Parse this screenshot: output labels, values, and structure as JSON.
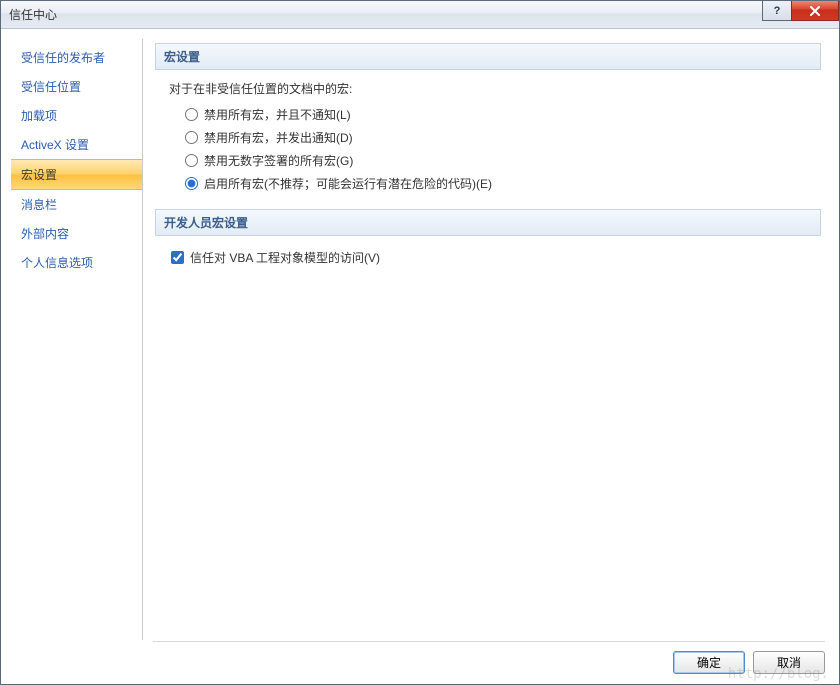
{
  "window": {
    "title": "信任中心"
  },
  "sidebar": {
    "items": [
      {
        "label": "受信任的发布者",
        "selected": false
      },
      {
        "label": "受信任位置",
        "selected": false
      },
      {
        "label": "加载项",
        "selected": false
      },
      {
        "label": "ActiveX 设置",
        "selected": false
      },
      {
        "label": "宏设置",
        "selected": true
      },
      {
        "label": "消息栏",
        "selected": false
      },
      {
        "label": "外部内容",
        "selected": false
      },
      {
        "label": "个人信息选项",
        "selected": false
      }
    ]
  },
  "sections": {
    "macro": {
      "header": "宏设置",
      "intro": "对于在非受信任位置的文档中的宏:",
      "options": [
        {
          "label": "禁用所有宏，并且不通知(L)",
          "checked": false
        },
        {
          "label": "禁用所有宏，并发出通知(D)",
          "checked": false
        },
        {
          "label": "禁用无数字签署的所有宏(G)",
          "checked": false
        },
        {
          "label": "启用所有宏(不推荐；可能会运行有潜在危险的代码)(E)",
          "checked": true
        }
      ]
    },
    "developer": {
      "header": "开发人员宏设置",
      "checkbox": {
        "label": "信任对 VBA 工程对象模型的访问(V)",
        "checked": true
      }
    }
  },
  "buttons": {
    "ok": "确定",
    "cancel": "取消"
  },
  "watermark": "http://blog."
}
